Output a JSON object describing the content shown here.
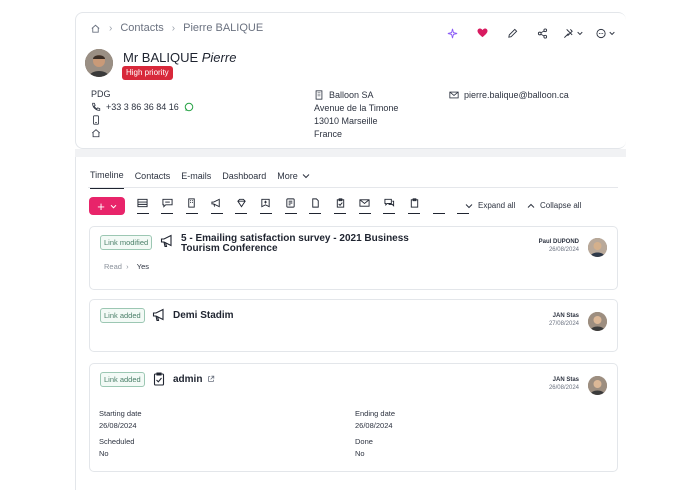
{
  "breadcrumb": {
    "contacts": "Contacts",
    "current": "Pierre BALIQUE"
  },
  "contact": {
    "civility_last": "Mr BALIQUE",
    "first_name": "Pierre",
    "priority": "High priority",
    "job_title": "PDG",
    "phone": "+33 3 86 36 84 16",
    "company": "Balloon SA",
    "address_line1": "Avenue de la Timone",
    "address_line2": "13010 Marseille",
    "country": "France",
    "email": "pierre.balique@balloon.ca"
  },
  "tabs": [
    {
      "label": "Timeline",
      "active": true
    },
    {
      "label": "Contacts"
    },
    {
      "label": "E-mails"
    },
    {
      "label": "Dashboard"
    },
    {
      "label": "More"
    }
  ],
  "toolbar": {
    "add": "+",
    "expand_all": "Expand all",
    "collapse_all": "Collapse all"
  },
  "timeline": [
    {
      "badge": "Link modified",
      "title_line1": "5 - Emailing satisfaction survey - 2021 Business",
      "title_line2": "Tourism Conference",
      "author": "Paul DUPOND",
      "date": "26/08/2024",
      "status_label": "Read",
      "status_value": "Yes"
    },
    {
      "badge": "Link added",
      "title": "Demi Stadim",
      "author": "JAN Stas",
      "date": "27/08/2024"
    },
    {
      "badge": "Link added",
      "title": "admin",
      "author": "JAN Stas",
      "date": "26/08/2024",
      "fields": {
        "start_label": "Starting date",
        "start_value": "26/08/2024",
        "end_label": "Ending date",
        "end_value": "26/08/2024",
        "scheduled_label": "Scheduled",
        "scheduled_value": "No",
        "done_label": "Done",
        "done_value": "No"
      }
    }
  ],
  "colors": {
    "accent": "#e8246a",
    "priority": "#d8283a",
    "whatsapp": "#25a244",
    "sparkle": "#8b5cf6"
  }
}
